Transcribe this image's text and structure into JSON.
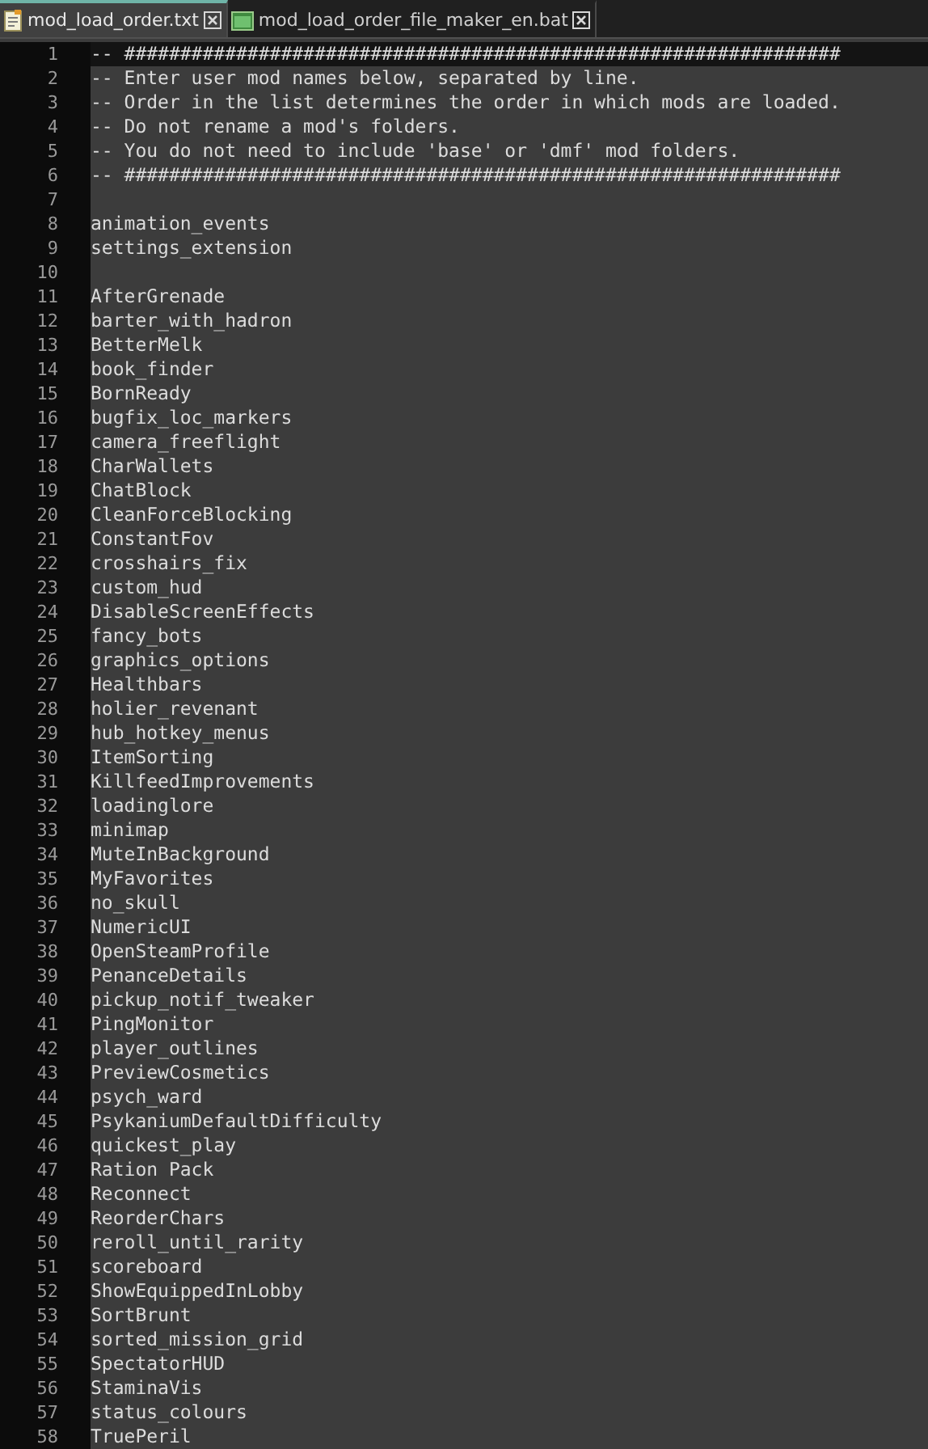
{
  "tabs": [
    {
      "label": "mod_load_order.txt",
      "kind": "text",
      "selected": true
    },
    {
      "label": "mod_load_order_file_maker_en.bat",
      "kind": "batch",
      "selected": false
    }
  ],
  "lines": [
    {
      "number": "1",
      "text": "-- ################################################################",
      "current": true
    },
    {
      "number": "2",
      "text": "-- Enter user mod names below, separated by line.",
      "current": false
    },
    {
      "number": "3",
      "text": "-- Order in the list determines the order in which mods are loaded.",
      "current": false
    },
    {
      "number": "4",
      "text": "-- Do not rename a mod's folders.",
      "current": false
    },
    {
      "number": "5",
      "text": "-- You do not need to include 'base' or 'dmf' mod folders.",
      "current": false
    },
    {
      "number": "6",
      "text": "-- ################################################################",
      "current": false
    },
    {
      "number": "7",
      "current": false
    },
    {
      "number": "8",
      "text": "animation_events",
      "current": false
    },
    {
      "number": "9",
      "text": "settings_extension",
      "current": false
    },
    {
      "number": "10",
      "current": false
    },
    {
      "number": "11",
      "text": "AfterGrenade",
      "current": false
    },
    {
      "number": "12",
      "text": "barter_with_hadron",
      "current": false
    },
    {
      "number": "13",
      "text": "BetterMelk",
      "current": false
    },
    {
      "number": "14",
      "text": "book_finder",
      "current": false
    },
    {
      "number": "15",
      "text": "BornReady",
      "current": false
    },
    {
      "number": "16",
      "text": "bugfix_loc_markers",
      "current": false
    },
    {
      "number": "17",
      "text": "camera_freeflight",
      "current": false
    },
    {
      "number": "18",
      "text": "CharWallets",
      "current": false
    },
    {
      "number": "19",
      "text": "ChatBlock",
      "current": false
    },
    {
      "number": "20",
      "text": "CleanForceBlocking",
      "current": false
    },
    {
      "number": "21",
      "text": "ConstantFov",
      "current": false
    },
    {
      "number": "22",
      "text": "crosshairs_fix",
      "current": false
    },
    {
      "number": "23",
      "text": "custom_hud",
      "current": false
    },
    {
      "number": "24",
      "text": "DisableScreenEffects",
      "current": false
    },
    {
      "number": "25",
      "text": "fancy_bots",
      "current": false
    },
    {
      "number": "26",
      "text": "graphics_options",
      "current": false
    },
    {
      "number": "27",
      "text": "Healthbars",
      "current": false
    },
    {
      "number": "28",
      "text": "holier_revenant",
      "current": false
    },
    {
      "number": "29",
      "text": "hub_hotkey_menus",
      "current": false
    },
    {
      "number": "30",
      "text": "ItemSorting",
      "current": false
    },
    {
      "number": "31",
      "text": "KillfeedImprovements",
      "current": false
    },
    {
      "number": "32",
      "text": "loadinglore",
      "current": false
    },
    {
      "number": "33",
      "text": "minimap",
      "current": false
    },
    {
      "number": "34",
      "text": "MuteInBackground",
      "current": false
    },
    {
      "number": "35",
      "text": "MyFavorites",
      "current": false
    },
    {
      "number": "36",
      "text": "no_skull",
      "current": false
    },
    {
      "number": "37",
      "text": "NumericUI",
      "current": false
    },
    {
      "number": "38",
      "text": "OpenSteamProfile",
      "current": false
    },
    {
      "number": "39",
      "text": "PenanceDetails",
      "current": false
    },
    {
      "number": "40",
      "text": "pickup_notif_tweaker",
      "current": false
    },
    {
      "number": "41",
      "text": "PingMonitor",
      "current": false
    },
    {
      "number": "42",
      "text": "player_outlines",
      "current": false
    },
    {
      "number": "43",
      "text": "PreviewCosmetics",
      "current": false
    },
    {
      "number": "44",
      "text": "psych_ward",
      "current": false
    },
    {
      "number": "45",
      "text": "PsykaniumDefaultDifficulty",
      "current": false
    },
    {
      "number": "46",
      "text": "quickest_play",
      "current": false
    },
    {
      "number": "47",
      "text": "Ration Pack",
      "current": false
    },
    {
      "number": "48",
      "text": "Reconnect",
      "current": false
    },
    {
      "number": "49",
      "text": "ReorderChars",
      "current": false
    },
    {
      "number": "50",
      "text": "reroll_until_rarity",
      "current": false
    },
    {
      "number": "51",
      "text": "scoreboard",
      "current": false
    },
    {
      "number": "52",
      "text": "ShowEquippedInLobby",
      "current": false
    },
    {
      "number": "53",
      "text": "SortBrunt",
      "current": false
    },
    {
      "number": "54",
      "text": "sorted_mission_grid",
      "current": false
    },
    {
      "number": "55",
      "text": "SpectatorHUD",
      "current": false
    },
    {
      "number": "56",
      "text": "StaminaVis",
      "current": false
    },
    {
      "number": "57",
      "text": "status_colours",
      "current": false
    },
    {
      "number": "58",
      "text": "TruePeril",
      "current": false
    }
  ]
}
